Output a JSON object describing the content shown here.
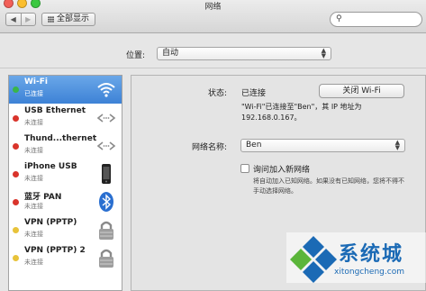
{
  "window": {
    "title": "网络",
    "show_all": "全部显示",
    "nav_back": "◀",
    "nav_forward": "▶",
    "search_placeholder": ""
  },
  "location": {
    "label": "位置:",
    "value": "自动"
  },
  "sidebar": {
    "items": [
      {
        "name": "Wi-Fi",
        "status": "已连接",
        "status_color": "#39b54a",
        "icon": "wifi-icon",
        "selected": true
      },
      {
        "name": "USB Ethernet",
        "status": "未连接",
        "status_color": "#d9342b",
        "icon": "ethernet-arrows-icon"
      },
      {
        "name": "Thund...thernet",
        "status": "未连接",
        "status_color": "#d9342b",
        "icon": "ethernet-arrows-icon"
      },
      {
        "name": "iPhone USB",
        "status": "未连接",
        "status_color": "#d9342b",
        "icon": "iphone-icon"
      },
      {
        "name": "蓝牙 PAN",
        "status": "未连接",
        "status_color": "#d9342b",
        "icon": "bluetooth-icon"
      },
      {
        "name": "VPN (PPTP)",
        "status": "未连接",
        "status_color": "#e8c33a",
        "icon": "lock-icon"
      },
      {
        "name": "VPN (PPTP) 2",
        "status": "未连接",
        "status_color": "#e8c33a",
        "icon": "lock-icon"
      }
    ]
  },
  "detail": {
    "status_label": "状态:",
    "status_value": "已连接",
    "turn_off_button": "关闭 Wi-Fi",
    "description_line1": "\"Wi-Fi\"已连接至\"Ben\"，其 IP 地址为",
    "description_line2": "192.168.0.167。",
    "network_name_label": "网络名称:",
    "network_name_value": "Ben",
    "ask_join_label": "询问加入新网络",
    "ask_join_hint": "将自动加入已知网络。如果没有已知网络，您将不得不手动选择网络。"
  },
  "watermark": {
    "text": "系统城",
    "url": "xitongcheng.com"
  },
  "colors": {
    "selected_row": "#4a8fdd",
    "watermark_blue": "#1b6ab5",
    "watermark_green": "#5bb53a"
  }
}
